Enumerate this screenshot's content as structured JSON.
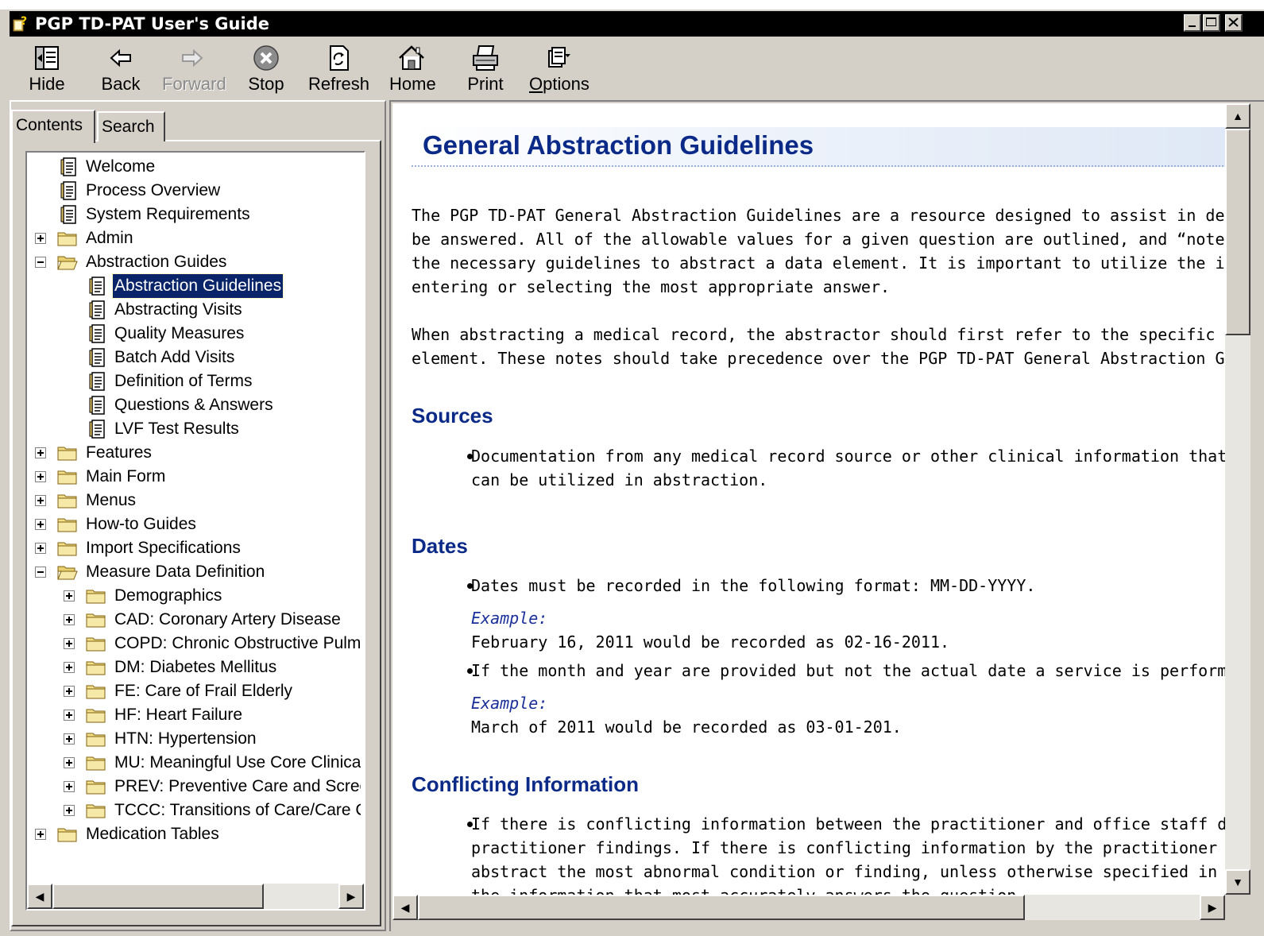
{
  "window": {
    "title": "PGP TD-PAT User's Guide",
    "controls": {
      "minimize": "_",
      "maximize": "□",
      "close": "✕"
    }
  },
  "toolbar": {
    "hide": "Hide",
    "back": "Back",
    "forward": "Forward",
    "stop": "Stop",
    "refresh": "Refresh",
    "home": "Home",
    "print": "Print",
    "options": "Options"
  },
  "tabs": {
    "contents": "Contents",
    "search": "Search",
    "active": "Contents"
  },
  "tree": [
    {
      "label": "Welcome",
      "type": "page",
      "level": 0
    },
    {
      "label": "Process Overview",
      "type": "page",
      "level": 0
    },
    {
      "label": "System Requirements",
      "type": "page",
      "level": 0
    },
    {
      "label": "Admin",
      "type": "folder",
      "level": 0,
      "expanded": false
    },
    {
      "label": "Abstraction Guides",
      "type": "folder",
      "level": 0,
      "expanded": true
    },
    {
      "label": "Abstraction Guidelines",
      "type": "page",
      "level": 1,
      "selected": true
    },
    {
      "label": "Abstracting Visits",
      "type": "page",
      "level": 1
    },
    {
      "label": "Quality Measures",
      "type": "page",
      "level": 1
    },
    {
      "label": "Batch Add Visits",
      "type": "page",
      "level": 1
    },
    {
      "label": "Definition of Terms",
      "type": "page",
      "level": 1
    },
    {
      "label": "Questions & Answers",
      "type": "page",
      "level": 1
    },
    {
      "label": "LVF Test Results",
      "type": "page",
      "level": 1
    },
    {
      "label": "Features",
      "type": "folder",
      "level": 0,
      "expanded": false
    },
    {
      "label": "Main Form",
      "type": "folder",
      "level": 0,
      "expanded": false
    },
    {
      "label": "Menus",
      "type": "folder",
      "level": 0,
      "expanded": false
    },
    {
      "label": "How-to Guides",
      "type": "folder",
      "level": 0,
      "expanded": false
    },
    {
      "label": "Import Specifications",
      "type": "folder",
      "level": 0,
      "expanded": false
    },
    {
      "label": "Measure Data Definition",
      "type": "folder",
      "level": 0,
      "expanded": true
    },
    {
      "label": "Demographics",
      "type": "folder",
      "level": 1,
      "expanded": false
    },
    {
      "label": "CAD: Coronary Artery Disease",
      "type": "folder",
      "level": 1,
      "expanded": false
    },
    {
      "label": "COPD: Chronic Obstructive Pulmor",
      "type": "folder",
      "level": 1,
      "expanded": false
    },
    {
      "label": "DM: Diabetes Mellitus",
      "type": "folder",
      "level": 1,
      "expanded": false
    },
    {
      "label": "FE: Care of Frail Elderly",
      "type": "folder",
      "level": 1,
      "expanded": false
    },
    {
      "label": "HF: Heart Failure",
      "type": "folder",
      "level": 1,
      "expanded": false
    },
    {
      "label": "HTN: Hypertension",
      "type": "folder",
      "level": 1,
      "expanded": false
    },
    {
      "label": "MU: Meaningful Use Core Clinical (",
      "type": "folder",
      "level": 1,
      "expanded": false
    },
    {
      "label": "PREV: Preventive Care and Screei",
      "type": "folder",
      "level": 1,
      "expanded": false
    },
    {
      "label": "TCCC: Transitions of Care/Care Co",
      "type": "folder",
      "level": 1,
      "expanded": false
    },
    {
      "label": "Medication Tables",
      "type": "folder",
      "level": 0,
      "expanded": false
    }
  ],
  "content": {
    "title": "General Abstraction Guidelines",
    "intro": [
      "The PGP TD-PAT General Abstraction Guidelines are a resource designed to assist in determinir",
      "be answered.  All of the allowable values for a given question are outlined, and “notes” are ofte",
      "the necessary guidelines to abstract a data element.  It is important to utilize the information fo",
      "entering or selecting the most appropriate answer."
    ],
    "intro2": [
      "When abstracting a medical record, the abstractor should first refer to the specific abstraction ir",
      "element.  These notes should take precedence over the PGP TD-PAT General Abstraction Guide"
    ],
    "sources": {
      "heading": "Sources",
      "bullet1": [
        "Documentation from any medical record source or other clinical information that is avail.",
        "can be utilized in abstraction."
      ]
    },
    "dates": {
      "heading": "Dates",
      "bullet1": "Dates must be recorded in the following format: MM-DD-YYYY.",
      "example_label": "Example:",
      "example1": "February 16, 2011 would be recorded as 02-16-2011.",
      "bullet2": "If the month and year are provided but not the actual date a service is performed, use t",
      "example2": "March of 2011 would be recorded as 03-01-201."
    },
    "conflicting": {
      "heading": "Conflicting Information",
      "lines": [
        "If there is conflicting information between the practitioner and office staff during an offic",
        "practitioner findings.  If there is conflicting information by the practitioner during an offic",
        "abstract the most abnormal condition or finding, unless otherwise specified in the abstrac",
        "the information that most accurately answers the question."
      ]
    }
  },
  "colors": {
    "heading": "#0b2a88",
    "selection": "#0a246a",
    "chrome": "#d4d0c8"
  }
}
